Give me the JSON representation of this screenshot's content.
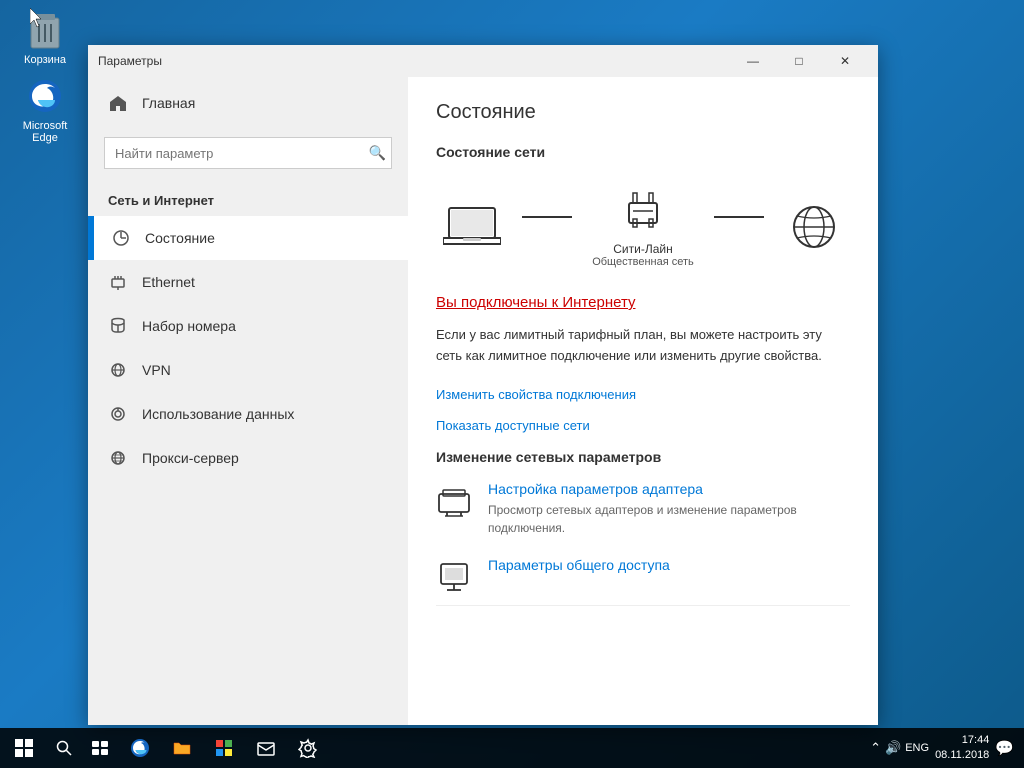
{
  "window": {
    "title": "Параметры",
    "controls": {
      "minimize": "—",
      "maximize": "□",
      "close": "✕"
    }
  },
  "desktop": {
    "icons": [
      {
        "id": "recycle-bin",
        "label": "Корзина"
      },
      {
        "id": "edge",
        "label": "Microsoft Edge"
      }
    ]
  },
  "sidebar": {
    "home_label": "Главная",
    "search_placeholder": "Найти параметр",
    "section_title": "Сеть и Интернет",
    "nav_items": [
      {
        "id": "status",
        "label": "Состояние",
        "active": true
      },
      {
        "id": "ethernet",
        "label": "Ethernet",
        "active": false
      },
      {
        "id": "dialup",
        "label": "Набор номера",
        "active": false
      },
      {
        "id": "vpn",
        "label": "VPN",
        "active": false
      },
      {
        "id": "data-usage",
        "label": "Использование данных",
        "active": false
      },
      {
        "id": "proxy",
        "label": "Прокси-сервер",
        "active": false
      }
    ]
  },
  "main": {
    "page_title": "Состояние",
    "network_status_title": "Состояние сети",
    "network_label1": "Сити-Лайн",
    "network_label2": "Общественная сеть",
    "connected_text": "Вы подключены к Интернету",
    "description": "Если у вас лимитный тарифный план, вы можете настроить эту сеть как лимитное подключение или изменить другие свойства.",
    "link_properties": "Изменить свойства подключения",
    "link_networks": "Показать доступные сети",
    "change_section_title": "Изменение сетевых параметров",
    "adapter_title": "Настройка параметров адаптера",
    "adapter_desc": "Просмотр сетевых адаптеров и изменение параметров подключения.",
    "sharing_title": "Параметры общего доступа"
  },
  "taskbar": {
    "time": "17:44",
    "date": "08.11.2018",
    "lang": "ENG"
  }
}
